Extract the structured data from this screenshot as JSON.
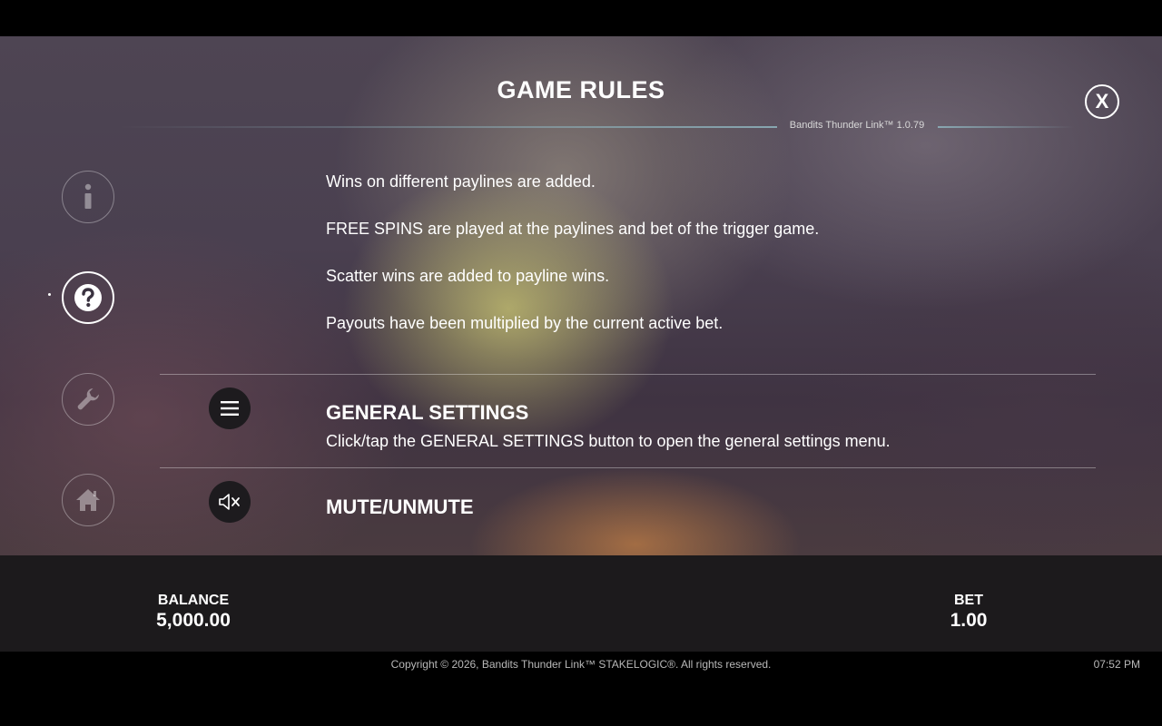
{
  "header": {
    "title": "GAME RULES",
    "version": "Bandits Thunder Link™ 1.0.79",
    "close_label": "X"
  },
  "nav": {
    "items": [
      {
        "name": "info",
        "icon": "info-icon",
        "active": false
      },
      {
        "name": "rules",
        "icon": "question-icon",
        "active": true
      },
      {
        "name": "settings",
        "icon": "wrench-icon",
        "active": false
      },
      {
        "name": "home",
        "icon": "home-icon",
        "active": false
      }
    ]
  },
  "rules": [
    "Wins on different paylines are added.",
    "FREE SPINS are played at the paylines and bet of the trigger game.",
    "Scatter wins are added to payline wins.",
    "Payouts have been multiplied by the current active bet."
  ],
  "sections": {
    "general_settings": {
      "title": "GENERAL SETTINGS",
      "description": "Click/tap the GENERAL SETTINGS button to open the general settings menu.",
      "icon": "menu-icon"
    },
    "mute": {
      "title": "MUTE/UNMUTE",
      "icon": "speaker-mute-icon"
    }
  },
  "footer_bar": {
    "balance_label": "BALANCE",
    "balance_value": "5,000.00",
    "bet_label": "BET",
    "bet_value": "1.00"
  },
  "footer": {
    "copyright": "Copyright © 2026, Bandits Thunder Link™ STAKELOGIC®. All rights reserved.",
    "time": "07:52 PM"
  },
  "colors": {
    "text": "#ffffff",
    "bar_background": "#1c1a1c",
    "accent_line": "#8cafb9"
  }
}
